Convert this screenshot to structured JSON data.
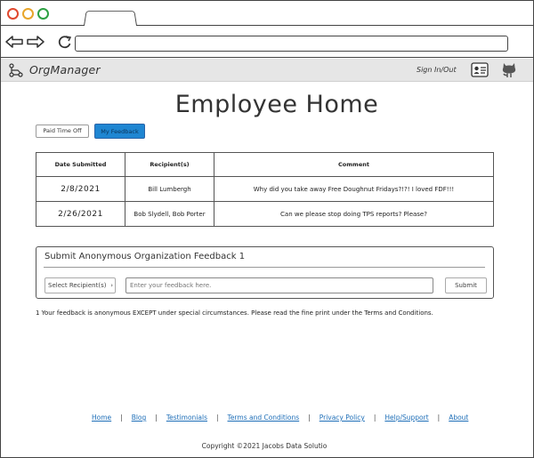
{
  "app": {
    "brand": "OrgManager",
    "sign_in": "Sign In/Out"
  },
  "page": {
    "title": "Employee Home"
  },
  "buttons": {
    "paid_time_off": "Paid Time Off",
    "my_feedback": "My Feedback"
  },
  "table": {
    "headers": [
      "Date Submitted",
      "Recipient(s)",
      "Comment"
    ],
    "rows": [
      {
        "date": "2/8/2021",
        "recipients": "Bill Lumbergh",
        "comment": "Why did you take away Free Doughnut Fridays?!?! I loved FDF!!!"
      },
      {
        "date": "2/26/2021",
        "recipients": "Bob Slydell, Bob Porter",
        "comment": "Can we please stop doing TPS reports? Please?"
      }
    ]
  },
  "submit_panel": {
    "title": "Submit Anonymous Organization Feedback 1",
    "select_placeholder": "Select Recipient(s)",
    "input_placeholder": "Enter your feedback here.",
    "submit_label": "Submit"
  },
  "footnote": "1 Your feedback is anonymous EXCEPT under special circumstances. Please read the fine print under the Terms and Conditions.",
  "footer": {
    "links": [
      "Home",
      "Blog",
      "Testimonials",
      "Terms and Conditions",
      "Privacy Policy",
      "Help/Support",
      "About"
    ],
    "copyright": "Copyright ©2021 Jacobs Data Solutio"
  },
  "icons": {
    "back": "arrow-left-icon",
    "forward": "arrow-right-icon",
    "reload": "reload-icon",
    "logo": "org-chart-icon",
    "profile": "id-card-icon",
    "github": "octocat-icon"
  },
  "colors": {
    "accent_button": "#1f86d2",
    "link": "#1f6fb8",
    "appbar_bg": "#e6e6e6",
    "dot_red": "#e0482e",
    "dot_yellow": "#e8a52a",
    "dot_green": "#2ea043"
  }
}
